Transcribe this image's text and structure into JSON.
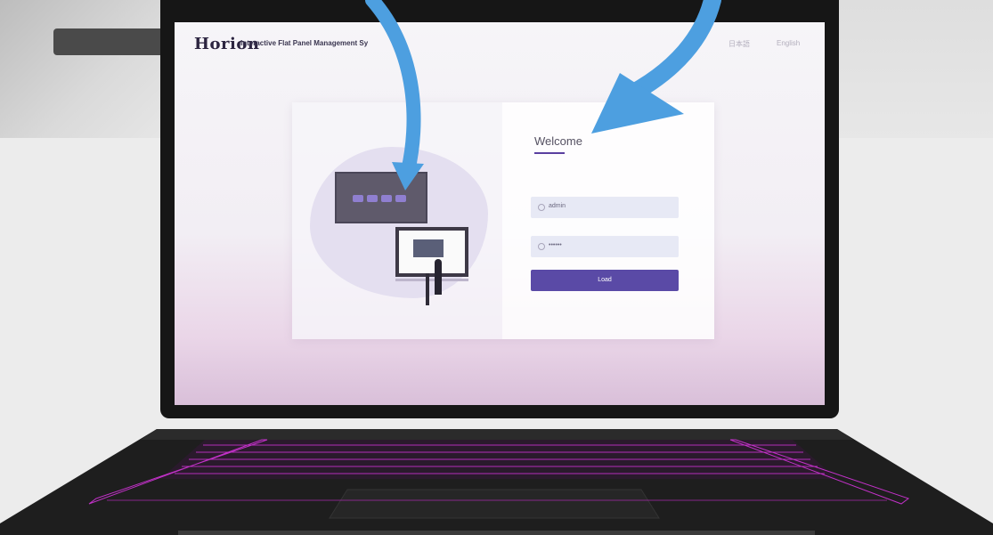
{
  "app": {
    "brand": "Horion",
    "title": "Interactive Flat Panel Management Sy",
    "header_links": [
      "日本語",
      "English"
    ]
  },
  "login": {
    "heading": "Welcome",
    "username_value": "admin",
    "password_value": "••••••",
    "submit_label": "Load"
  },
  "colors": {
    "accent": "#5a4aa6",
    "arrow": "#4d9fe0",
    "keyboard_glow": "#c231c8"
  },
  "icons": [
    "user-icon",
    "lock-icon"
  ]
}
